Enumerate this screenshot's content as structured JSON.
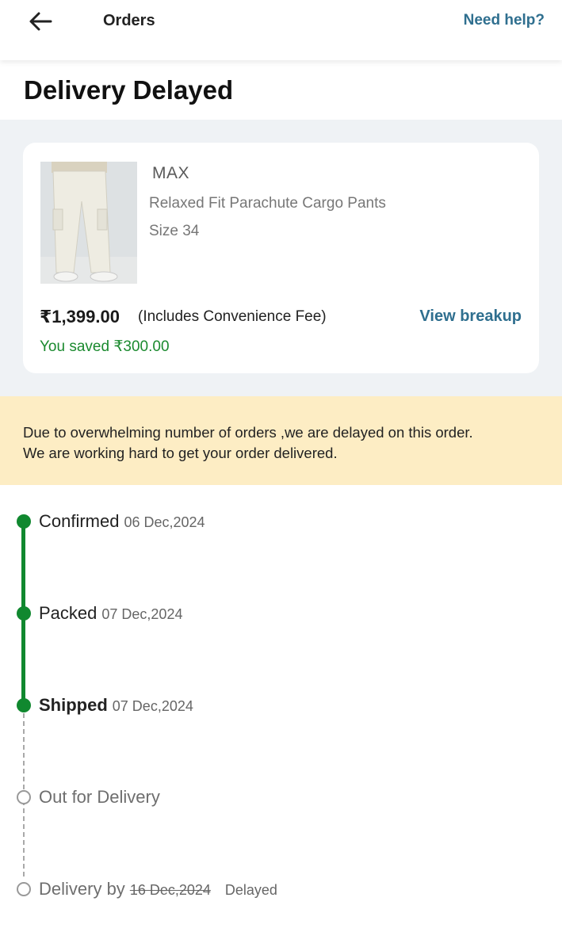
{
  "header": {
    "title": "Orders",
    "help_label": "Need help?"
  },
  "status": {
    "title": "Delivery Delayed"
  },
  "product": {
    "brand": "MAX",
    "name": "Relaxed Fit Parachute Cargo Pants",
    "size": "Size 34",
    "price": "₹1,399.00",
    "fee_note": "(Includes Convenience Fee)",
    "breakup_label": "View breakup",
    "saved": "You saved  ₹300.00"
  },
  "notice": {
    "line1": "Due to overwhelming number of orders ,we are delayed on this order.",
    "line2": "We are working hard to get your order delivered."
  },
  "timeline": {
    "steps": [
      {
        "label": "Confirmed",
        "date": "06 Dec,2024"
      },
      {
        "label": "Packed",
        "date": "07 Dec,2024"
      },
      {
        "label": "Shipped",
        "date": "07 Dec,2024"
      },
      {
        "label": "Out for Delivery"
      },
      {
        "label": "Delivery by",
        "original_date": "16 Dec,2024",
        "tag": "Delayed"
      }
    ]
  },
  "colors": {
    "accent_link": "#2f6f8f",
    "success_green": "#10882f",
    "notice_bg": "#fdedc4",
    "band_bg": "#eff2f5"
  }
}
